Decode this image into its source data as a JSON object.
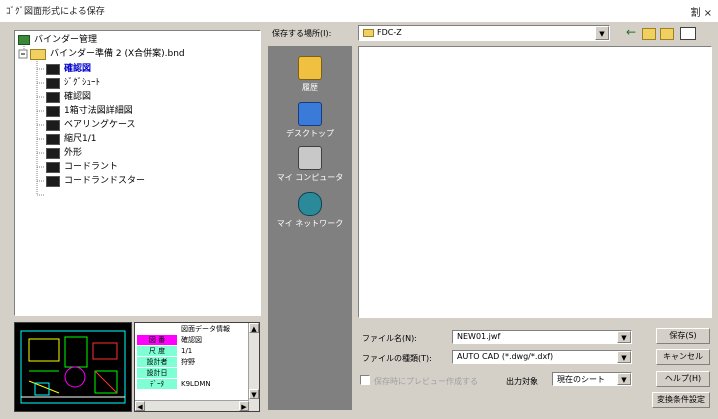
{
  "window": {
    "title": "ｺﾞｸﾞ図面形式による保存",
    "close_label": "割 ×"
  },
  "tree": {
    "items": [
      {
        "label": "バインダー管理",
        "level": 0,
        "icon": "binder-root-icon"
      },
      {
        "label": "バインダー準備 2 (X合併案).bnd",
        "level": 1,
        "icon": "folder-icon"
      },
      {
        "label": "確認図",
        "level": 2,
        "icon": "sheet-icon",
        "selected": true
      },
      {
        "label": "ｼﾞｸﾞｼｭｰﾄ",
        "level": 2,
        "icon": "sheet-icon"
      },
      {
        "label": "確認図",
        "level": 2,
        "icon": "sheet-icon"
      },
      {
        "label": "1箱寸法図詳細図",
        "level": 2,
        "icon": "sheet-icon"
      },
      {
        "label": "ベアリングケース",
        "level": 2,
        "icon": "sheet-icon"
      },
      {
        "label": "縮尺1/1",
        "level": 2,
        "icon": "sheet-icon"
      },
      {
        "label": "外形",
        "level": 2,
        "icon": "sheet-icon"
      },
      {
        "label": "コードラント",
        "level": 2,
        "icon": "sheet-icon"
      },
      {
        "label": "コードランドスター",
        "level": 2,
        "icon": "sheet-icon"
      }
    ]
  },
  "properties": {
    "header": "図面データ情報",
    "rows": [
      {
        "key": "図 番",
        "value": "確認図",
        "color": "#ff00ff"
      },
      {
        "key": "尺 度",
        "value": "1/1",
        "color": "#7fffd4"
      },
      {
        "key": "設計者",
        "value": "狩野",
        "color": "#7fffd4"
      },
      {
        "key": "設計日",
        "value": "",
        "color": "#7fffd4"
      },
      {
        "key": "ﾃﾞｰﾀ",
        "value": "K9LDMN",
        "color": "#7fffd4"
      }
    ]
  },
  "lookin": {
    "label": "保存する場所(I):",
    "value": "FDC-Z"
  },
  "places": [
    {
      "label": "履歴",
      "icon": "history-icon"
    },
    {
      "label": "デスクトップ",
      "icon": "desktop-icon"
    },
    {
      "label": "マイ コンピュータ",
      "icon": "my-computer-icon"
    },
    {
      "label": "マイ ネットワーク",
      "icon": "network-icon"
    }
  ],
  "form": {
    "filename_label": "ファイル名(N):",
    "filename_value": "NEW01.jwf",
    "filetype_label": "ファイルの種類(T):",
    "filetype_value": "AUTO CAD (*.dwg/*.dxf)",
    "checkbox_label": "保存時にプレビュー作成する",
    "output_label": "出力対象",
    "output_value": "現在のシート"
  },
  "buttons": {
    "save": "保存(S)",
    "cancel": "キャンセル",
    "help": "ヘルプ(H)",
    "conditions": "変換条件設定"
  },
  "colors": {
    "places_bg": "#808080",
    "dialog_bg": "#d4d0c8"
  }
}
